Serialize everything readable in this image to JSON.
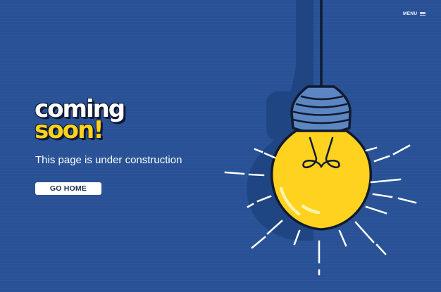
{
  "nav": {
    "menu_label": "MENU",
    "menu_icon": "hamburger-icon"
  },
  "hero": {
    "title_line1": "coming",
    "title_line2": "soon!",
    "subtitle": "This page is under construction",
    "cta_label": "GO HOME"
  },
  "illustration": {
    "icon": "light-bulb-icon"
  },
  "colors": {
    "background": "#285196",
    "accent_yellow": "#ffd21f",
    "socket_blue": "#5b86c2",
    "outline": "#0f1a33",
    "text": "#ffffff"
  }
}
